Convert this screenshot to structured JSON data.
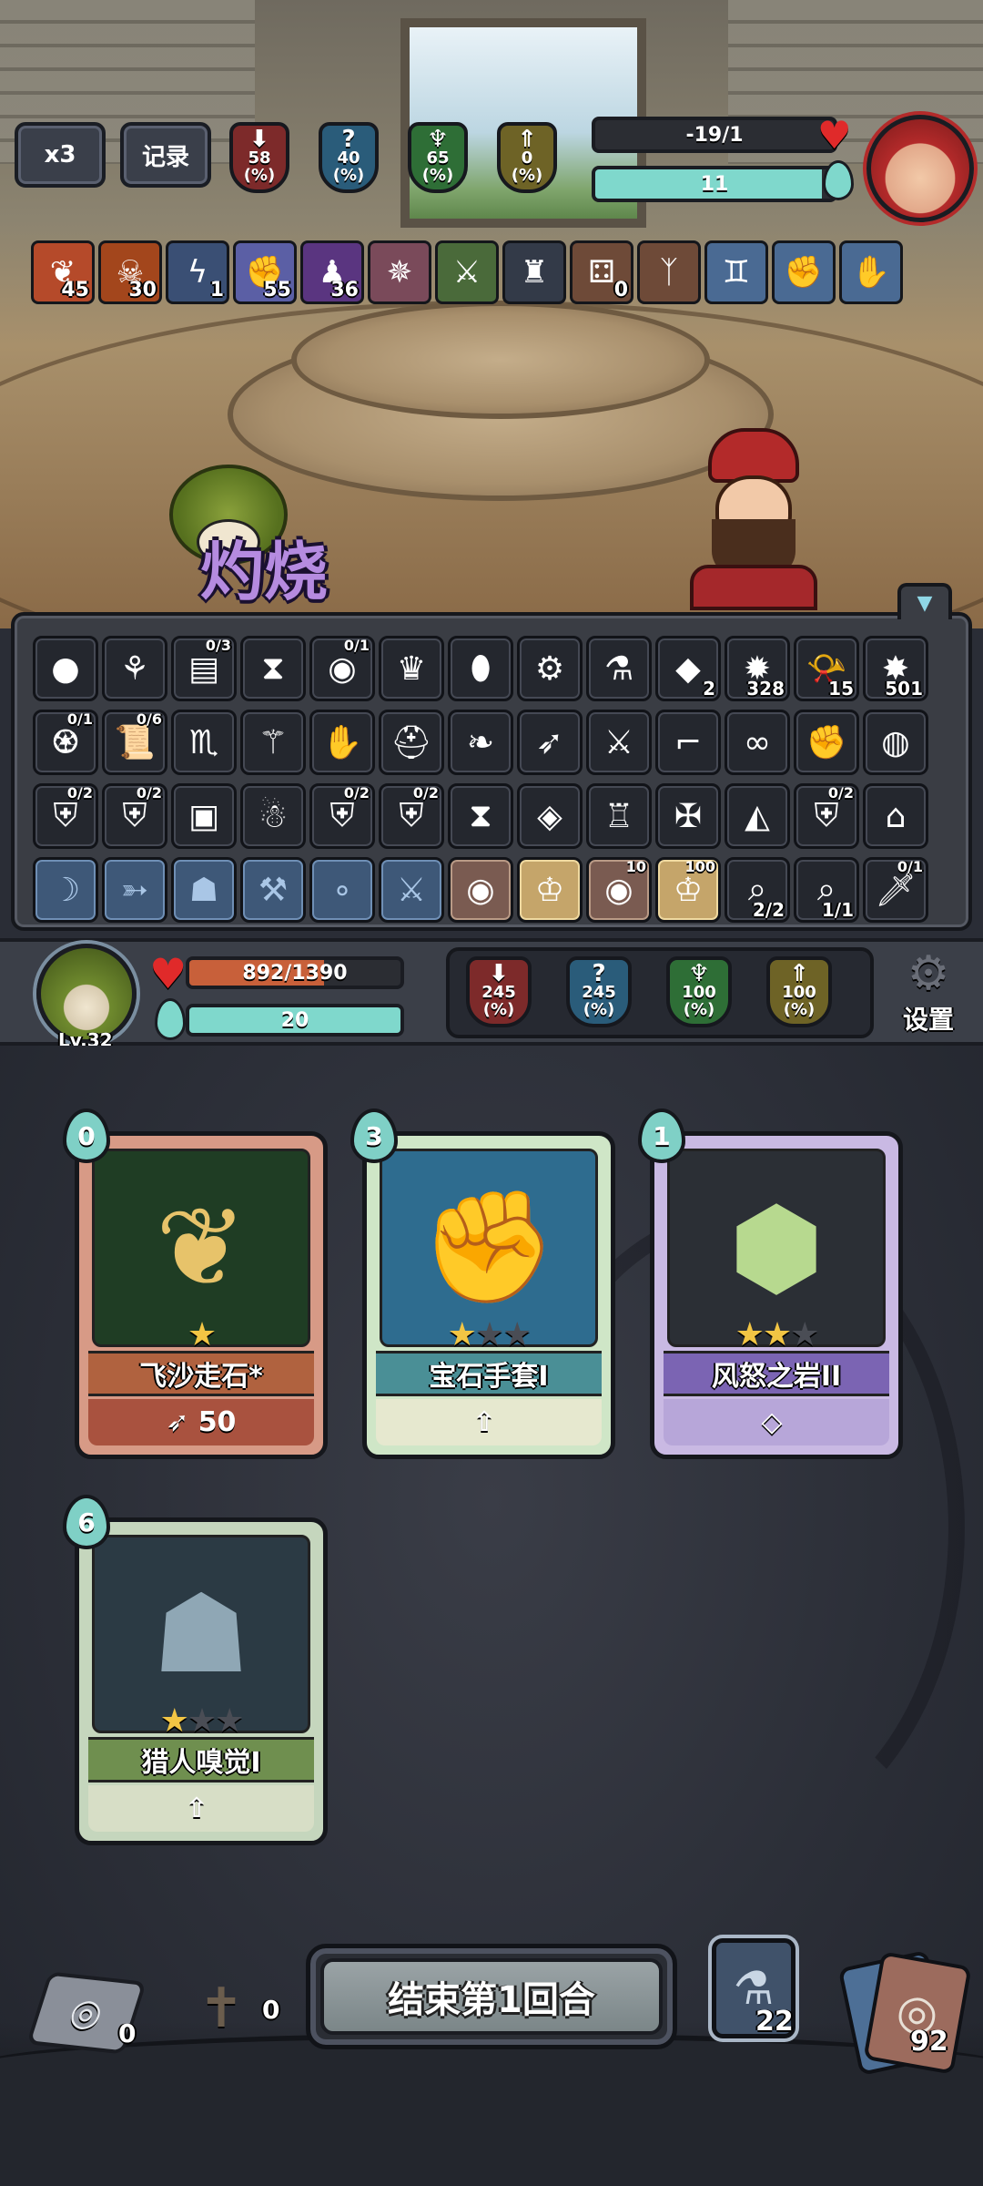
{
  "hud": {
    "speed_label": "x3",
    "record_label": "记录",
    "enemy_stats": [
      {
        "value": "58",
        "unit": "(%)",
        "icon": "red-shield-down-icon",
        "color": "#b33a3a"
      },
      {
        "value": "40",
        "unit": "(%)",
        "icon": "blue-question-shield-icon",
        "color": "#3f7fa3"
      },
      {
        "value": "65",
        "unit": "(%)",
        "icon": "green-trident-shield-icon",
        "color": "#3f8f4a"
      },
      {
        "value": "0",
        "unit": "(%)",
        "icon": "gold-arrow-shield-icon",
        "color": "#a08a32"
      }
    ],
    "enemy_hp": "-19/1",
    "enemy_energy": "11",
    "enemy_hp_fill": 0.0,
    "enemy_energy_fill": 0.95
  },
  "buffs": [
    {
      "icon": "flame-swirl-icon",
      "count": "45",
      "color": "#b54a2a"
    },
    {
      "icon": "fire-skull-icon",
      "count": "30",
      "color": "#a3461c"
    },
    {
      "icon": "lightning-icon",
      "count": "1",
      "color": "#3a4f74"
    },
    {
      "icon": "muscle-arm-icon",
      "count": "55",
      "color": "#5b5fa5"
    },
    {
      "icon": "purple-silhouette-icon",
      "count": "36",
      "color": "#5a3580"
    },
    {
      "icon": "burning-bird-icon",
      "count": "",
      "color": "#7a4a5a"
    },
    {
      "icon": "green-dagger-icon",
      "count": "",
      "color": "#4a6a3a"
    },
    {
      "icon": "dark-cannon-icon",
      "count": "",
      "color": "#333a48"
    },
    {
      "icon": "brown-dice-icon",
      "count": "0",
      "color": "#6e4a38"
    },
    {
      "icon": "brown-rune-icon",
      "count": "",
      "color": "#6e4a38"
    },
    {
      "icon": "blue-twins-icon",
      "count": "",
      "color": "#4a6a93"
    },
    {
      "icon": "blue-fist-icon",
      "count": "",
      "color": "#4a6a93"
    },
    {
      "icon": "blue-flex-icon",
      "count": "",
      "color": "#4a6a93"
    }
  ],
  "floating_text": "灼烧",
  "relic_rows": [
    [
      {
        "icon": "coconut-icon",
        "label": ""
      },
      {
        "icon": "golden-sandal-icon",
        "label": ""
      },
      {
        "icon": "spellbook-icon",
        "label": "",
        "top": "0/3"
      },
      {
        "icon": "hourglass-tag-icon",
        "label": ""
      },
      {
        "icon": "crystal-ball-icon",
        "label": "",
        "top": "0/1"
      },
      {
        "icon": "black-crown-icon",
        "label": ""
      },
      {
        "icon": "red-egg-icon",
        "label": ""
      },
      {
        "icon": "wood-gear-icon",
        "label": ""
      },
      {
        "icon": "blue-flask-icon",
        "label": ""
      },
      {
        "icon": "green-stone-icon",
        "label": "2"
      },
      {
        "icon": "durian-icon",
        "label": "328"
      },
      {
        "icon": "horn-icon",
        "label": "15"
      },
      {
        "icon": "white-burst-icon",
        "label": "501"
      }
    ],
    [
      {
        "icon": "money-bag-icon",
        "label": "",
        "top": "0/1"
      },
      {
        "icon": "scroll-icon",
        "label": "",
        "top": "0/6"
      },
      {
        "icon": "scorpion-icon",
        "label": ""
      },
      {
        "icon": "broom-icon",
        "label": ""
      },
      {
        "icon": "red-gauntlet-icon",
        "label": ""
      },
      {
        "icon": "green-helmet-icon",
        "label": ""
      },
      {
        "icon": "white-wings-icon",
        "label": ""
      },
      {
        "icon": "kunai-icon",
        "label": ""
      },
      {
        "icon": "blue-sword-icon",
        "label": ""
      },
      {
        "icon": "musket-icon",
        "label": ""
      },
      {
        "icon": "rope-icon",
        "label": ""
      },
      {
        "icon": "boxing-glove-icon",
        "label": ""
      },
      {
        "icon": "green-slime-icon",
        "label": ""
      }
    ],
    [
      {
        "icon": "green-shield-badge-icon",
        "label": "",
        "top": "0/2"
      },
      {
        "icon": "blue-shield-badge-icon",
        "label": "",
        "top": "0/2"
      },
      {
        "icon": "framed-painting-icon",
        "label": ""
      },
      {
        "icon": "ghost-icon",
        "label": ""
      },
      {
        "icon": "teal-shield-badge-icon",
        "label": "",
        "top": "0/2"
      },
      {
        "icon": "purple-shield-badge-icon",
        "label": "",
        "top": "0/2"
      },
      {
        "icon": "hourglass-icon",
        "label": ""
      },
      {
        "icon": "rune-book-icon",
        "label": ""
      },
      {
        "icon": "treasure-sack-icon",
        "label": ""
      },
      {
        "icon": "cross-bundle-icon",
        "label": ""
      },
      {
        "icon": "cheese-icon",
        "label": ""
      },
      {
        "icon": "red-shield-badge-icon",
        "label": "",
        "top": "0/2"
      },
      {
        "icon": "white-boot-icon",
        "label": ""
      }
    ],
    [
      {
        "icon": "bow-icon",
        "label": "",
        "style": "blue"
      },
      {
        "icon": "crossbow-icon",
        "label": "",
        "style": "blue"
      },
      {
        "icon": "totem-icon",
        "label": "",
        "style": "blue"
      },
      {
        "icon": "pickaxe-icon",
        "label": "",
        "style": "blue"
      },
      {
        "icon": "bubbles-icon",
        "label": "",
        "style": "blue"
      },
      {
        "icon": "crossed-guns-icon",
        "label": "",
        "style": "blue"
      },
      {
        "icon": "eye-icon",
        "label": "",
        "style": "rose"
      },
      {
        "icon": "gold-crown-spikes-icon",
        "label": "",
        "style": "gold"
      },
      {
        "icon": "eye-dark-icon",
        "label": "",
        "top": "10",
        "style": "rose"
      },
      {
        "icon": "gold-spikes-icon",
        "label": "",
        "top": "100",
        "style": "gold"
      },
      {
        "icon": "telescope-icon",
        "label": "2/2"
      },
      {
        "icon": "purple-telescope-icon",
        "label": "1/1"
      },
      {
        "icon": "machete-icon",
        "label": "",
        "top": "0/1"
      }
    ]
  ],
  "player": {
    "level": "Lv.32",
    "hp": "892/1390",
    "hp_fill": 0.64,
    "energy": "20",
    "energy_fill": 1.0,
    "stats": [
      {
        "value": "245",
        "unit": "(%)",
        "icon": "red-shield-down-icon",
        "color": "#b33a3a"
      },
      {
        "value": "245",
        "unit": "(%)",
        "icon": "blue-question-shield-icon",
        "color": "#3f7fa3"
      },
      {
        "value": "100",
        "unit": "(%)",
        "icon": "green-trident-shield-icon",
        "color": "#3f8f4a"
      },
      {
        "value": "100",
        "unit": "(%)",
        "icon": "gold-arrow-shield-icon",
        "color": "#a08a32"
      }
    ],
    "settings_label": "设置"
  },
  "cards": [
    {
      "name": "飞沙走石*",
      "cost": "0",
      "stars": 1,
      "max_stars": 1,
      "footer": "50",
      "footer_icon": "wing-icon",
      "frame": "#d79a86",
      "title_bg": "#b0623f",
      "foot_bg": "#a9523f",
      "art_bg": "#1f3d24",
      "art_icon": "golden-vines-icon"
    },
    {
      "name": "宝石手套I",
      "cost": "3",
      "stars": 1,
      "max_stars": 3,
      "footer": "",
      "footer_icon": "upgrade-arrow-icon",
      "frame": "#cfe6c7",
      "title_bg": "#4a8f96",
      "foot_bg": "#e6e8cf",
      "art_bg": "#2e6c8f",
      "art_icon": "gem-gauntlet-icon"
    },
    {
      "name": "风怒之岩II",
      "cost": "1",
      "stars": 2,
      "max_stars": 3,
      "footer": "",
      "footer_icon": "diamond-icon",
      "frame": "#c9b9e3",
      "title_bg": "#7b64b3",
      "foot_bg": "#b7a6d9",
      "art_bg": "#2b2f35",
      "art_icon": "wind-rock-icon"
    },
    {
      "name": "猎人嗅觉I",
      "cost": "6",
      "stars": 1,
      "max_stars": 3,
      "footer": "",
      "footer_icon": "upgrade-arrow-icon",
      "frame": "#c5d6bd",
      "title_bg": "#6f8f4f",
      "foot_bg": "#d7dec6",
      "art_bg": "#2b3a44",
      "art_icon": "hunter-silhouette-icon"
    }
  ],
  "bottom": {
    "draw_pile_count": "0",
    "grave_count": "0",
    "end_turn_label": "结束第1回合",
    "potion_count": "22",
    "deck_count": "92"
  }
}
